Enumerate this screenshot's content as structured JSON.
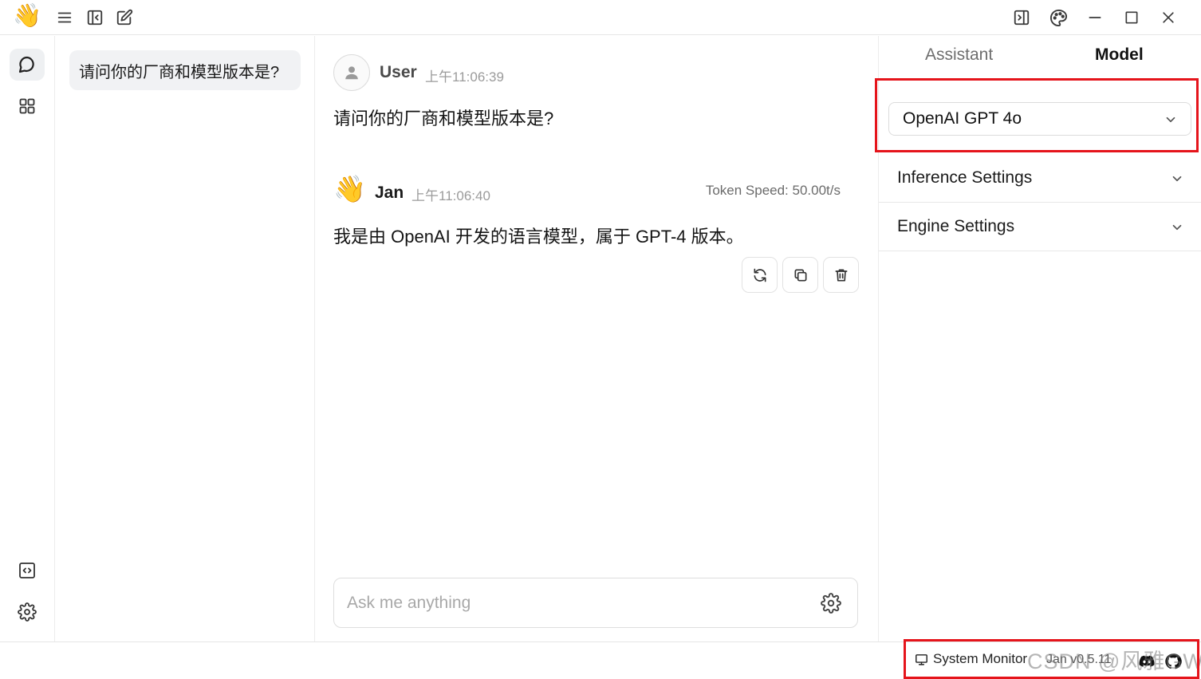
{
  "app": {
    "logo_emoji": "👋"
  },
  "thread_list": {
    "items": [
      {
        "title": "请问你的厂商和模型版本是?"
      }
    ]
  },
  "chat": {
    "user_message": {
      "author": "User",
      "time": "上午11:06:39",
      "text": "请问你的厂商和模型版本是?"
    },
    "assistant_message": {
      "author": "Jan",
      "avatar_emoji": "👋",
      "time": "上午11:06:40",
      "token_speed": "Token Speed: 50.00t/s",
      "text": "我是由 OpenAI 开发的语言模型，属于 GPT-4 版本。"
    },
    "composer": {
      "placeholder": "Ask me anything"
    }
  },
  "right_panel": {
    "tabs": [
      {
        "label": "Assistant",
        "active": false
      },
      {
        "label": "Model",
        "active": true
      }
    ],
    "model_select": {
      "value": "OpenAI GPT 4o"
    },
    "sections": [
      {
        "label": "Inference Settings"
      },
      {
        "label": "Engine Settings"
      }
    ]
  },
  "status_bar": {
    "system_monitor": "System Monitor",
    "version": "Jan v0.5.11",
    "watermark": "CSDN @风雅GW"
  },
  "colors": {
    "highlight": "#e5141b",
    "active_bg": "#eef0f2"
  }
}
